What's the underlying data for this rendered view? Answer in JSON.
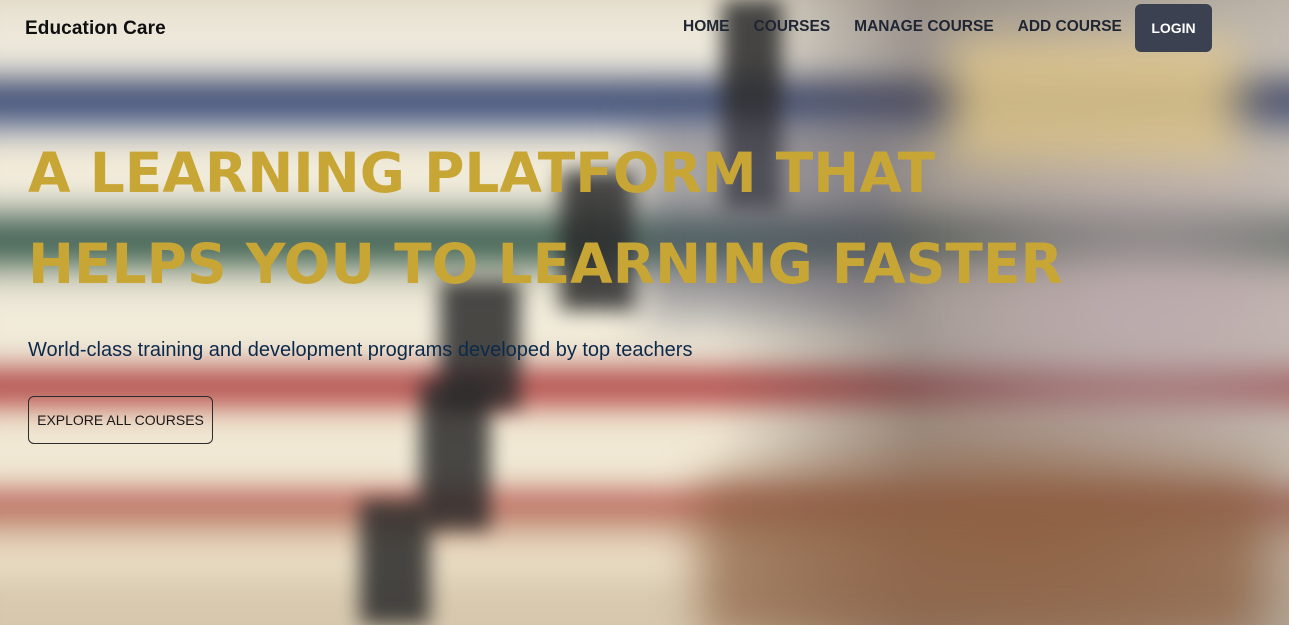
{
  "header": {
    "brand": "Education Care",
    "nav": [
      {
        "label": "HOME"
      },
      {
        "label": "COURSES"
      },
      {
        "label": "MANAGE COURSE"
      },
      {
        "label": "ADD COURSE"
      }
    ],
    "login_label": "LOGIN"
  },
  "hero": {
    "title": "A LEARNING PLATFORM THAT HELPS YOU TO LEARNING FASTER",
    "subtitle": "World-class training and development programs developed by top teachers",
    "cta_label": "EXPLORE ALL COURSES"
  },
  "colors": {
    "title": "#c8a636",
    "subtitle": "#0b2a4a",
    "login_bg": "#3b4151"
  }
}
